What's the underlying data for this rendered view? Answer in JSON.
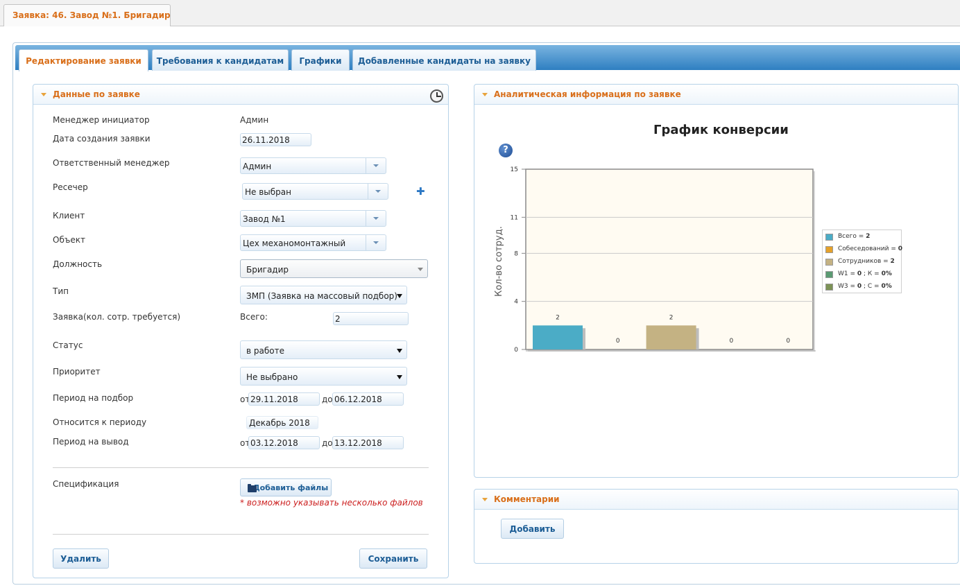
{
  "page_tab": {
    "label": "Заявка: 46. Завод №1. Бригадир"
  },
  "tabs": [
    {
      "label": "Редактирование заявки",
      "active": true
    },
    {
      "label": "Требования к кандидатам",
      "active": false
    },
    {
      "label": "Графики",
      "active": false
    },
    {
      "label": "Добавленные кандидаты на заявку",
      "active": false
    }
  ],
  "request_panel": {
    "title": "Данные по заявке",
    "fields": {
      "manager_initiator": {
        "label": "Менеджер инициатор",
        "value": "Админ"
      },
      "created_date": {
        "label": "Дата создания заявки",
        "value": "26.11.2018"
      },
      "responsible_manager": {
        "label": "Ответственный менеджер",
        "value": "Админ"
      },
      "researcher": {
        "label": "Ресечер",
        "value": "Не выбран"
      },
      "client": {
        "label": "Клиент",
        "value": "Завод №1"
      },
      "object": {
        "label": "Объект",
        "value": "Цех механомонтажный"
      },
      "position": {
        "label": "Должность",
        "value": "Бригадир"
      },
      "type": {
        "label": "Тип",
        "value": "ЗМП (Заявка на массовый подбор)"
      },
      "quantity": {
        "label": "Заявка(кол. сотр. требуется)",
        "total_label": "Всего:",
        "value": "2"
      },
      "status": {
        "label": "Статус",
        "value": "в работе"
      },
      "priority": {
        "label": "Приоритет",
        "value": "Не выбрано"
      },
      "selection_period": {
        "label": "Период на подбор",
        "from_label": "от",
        "from": "29.11.2018",
        "to_label": "до",
        "to": "06.12.2018"
      },
      "relates_to_period": {
        "label": "Относится к периоду",
        "value": "Декабрь 2018"
      },
      "output_period": {
        "label": "Период на вывод",
        "from_label": "от",
        "from": "03.12.2018",
        "to_label": "до",
        "to": "13.12.2018"
      },
      "specification": {
        "label": "Спецификация",
        "button_label": "Добавить файлы",
        "hint": "* возможно указывать несколько файлов"
      }
    },
    "delete_label": "Удалить",
    "save_label": "Сохранить"
  },
  "analytics_panel": {
    "title": "Аналитическая информация по заявке",
    "help_label": "?"
  },
  "comments_panel": {
    "title": "Комментарии",
    "add_label": "Добавить"
  },
  "chart_data": {
    "type": "bar",
    "title": "График конверсии",
    "ylabel": "Кол-во сотруд.",
    "xlabel": "",
    "ylim": [
      0,
      15
    ],
    "yticks": [
      "0",
      "4",
      "8",
      "11",
      "15"
    ],
    "categories": [
      "Всего",
      "Собеседований",
      "Сотрудников",
      "W1",
      "W3"
    ],
    "values": [
      2,
      0,
      2,
      0,
      0
    ],
    "colors": [
      "#4bacc6",
      "#e5a12a",
      "#c4b283",
      "#5a9a72",
      "#7c9256"
    ],
    "legend": [
      {
        "prefix": "Всего = ",
        "bold": "2"
      },
      {
        "prefix": "Собеседований = ",
        "bold": "0"
      },
      {
        "prefix": "Сотрудников = ",
        "bold": "2"
      },
      {
        "prefix": "W1 = ",
        "bold": "0",
        "suffix": " ; К = ",
        "bold2": "0%"
      },
      {
        "prefix": "W3 = ",
        "bold": "0",
        "suffix": " ; С = ",
        "bold2": "0%"
      }
    ],
    "grid": true,
    "legend_position": "right"
  }
}
